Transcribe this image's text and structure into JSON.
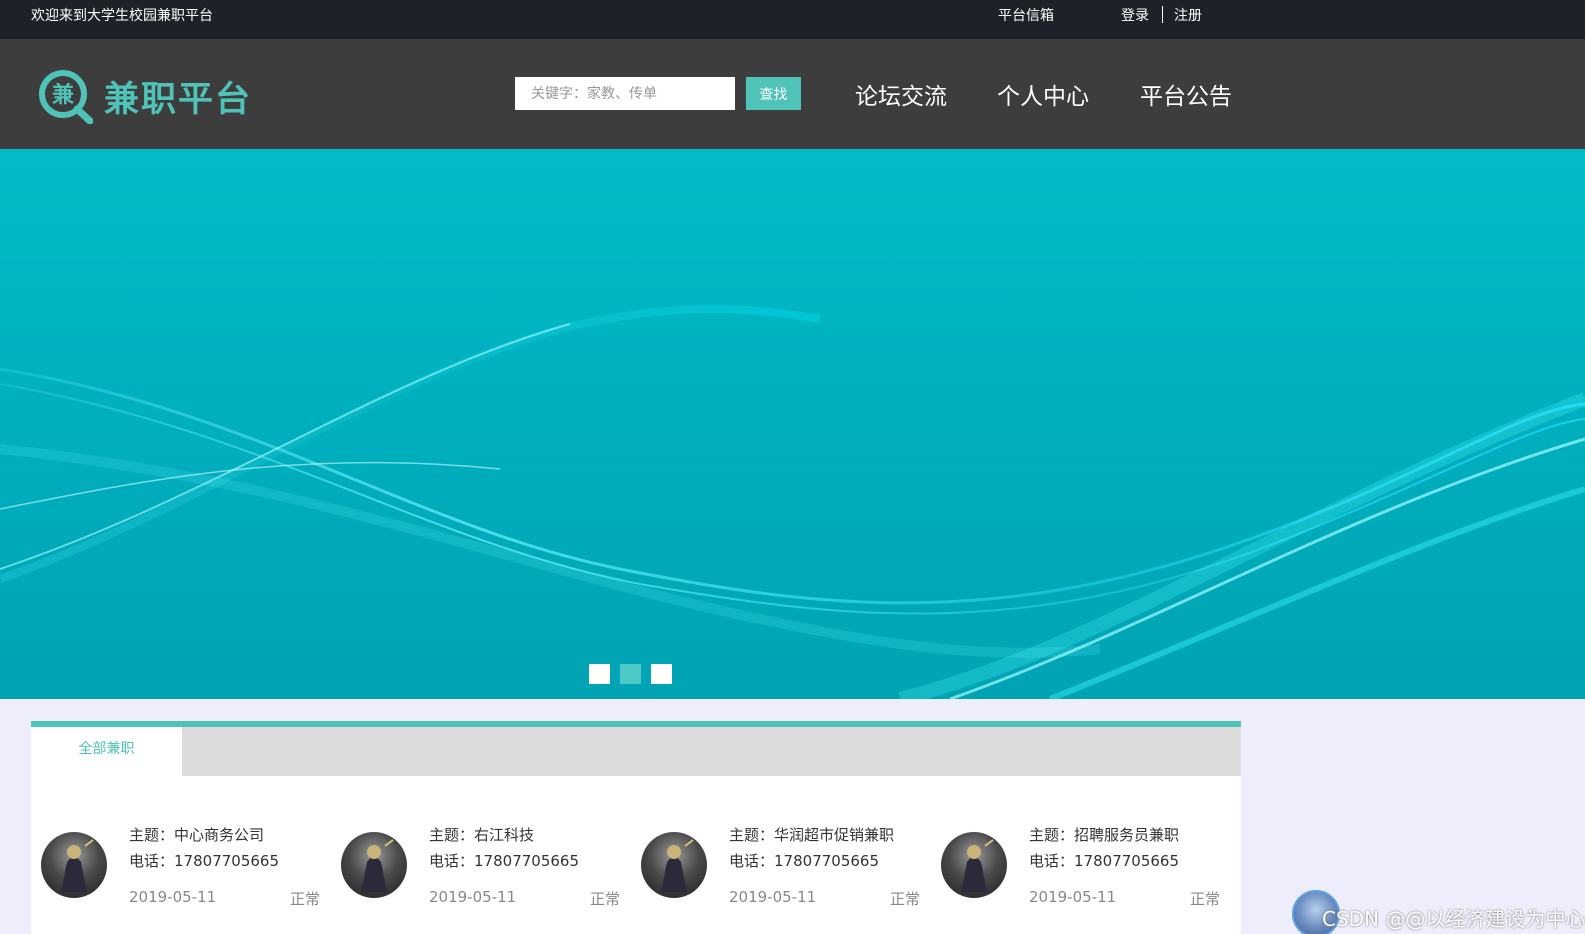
{
  "topbar": {
    "welcome": "欢迎来到大学生校园兼职平台",
    "mailbox": "平台信箱",
    "login": "登录",
    "register": "注册"
  },
  "header": {
    "logo_char": "兼",
    "logo_text": "兼职平台",
    "search_placeholder": "关键字：家教、传单",
    "search_button": "查找",
    "nav": [
      "论坛交流",
      "个人中心",
      "平台公告"
    ]
  },
  "banner": {
    "slide_count": 3,
    "active_slide": 2
  },
  "jobs": {
    "tab_label": "全部兼职",
    "subject_prefix": "主题：",
    "phone_prefix": "电话：",
    "items": [
      {
        "subject": "中心商务公司",
        "phone": "17807705665",
        "date": "2019-05-11",
        "status": "正常"
      },
      {
        "subject": "右江科技",
        "phone": "17807705665",
        "date": "2019-05-11",
        "status": "正常"
      },
      {
        "subject": "华润超市促销兼职",
        "phone": "17807705665",
        "date": "2019-05-11",
        "status": "正常"
      },
      {
        "subject": "招聘服务员兼职",
        "phone": "17807705665",
        "date": "2019-05-11",
        "status": "正常"
      }
    ]
  },
  "watermark": {
    "text": "CSDN @@以经济建设为中心"
  },
  "colors": {
    "accent": "#4fc3b8",
    "topbar_bg": "#1f2128",
    "header_bg": "#3d3d3d",
    "banner_bg": "#00b0bf",
    "page_bg": "#eeedfc"
  }
}
